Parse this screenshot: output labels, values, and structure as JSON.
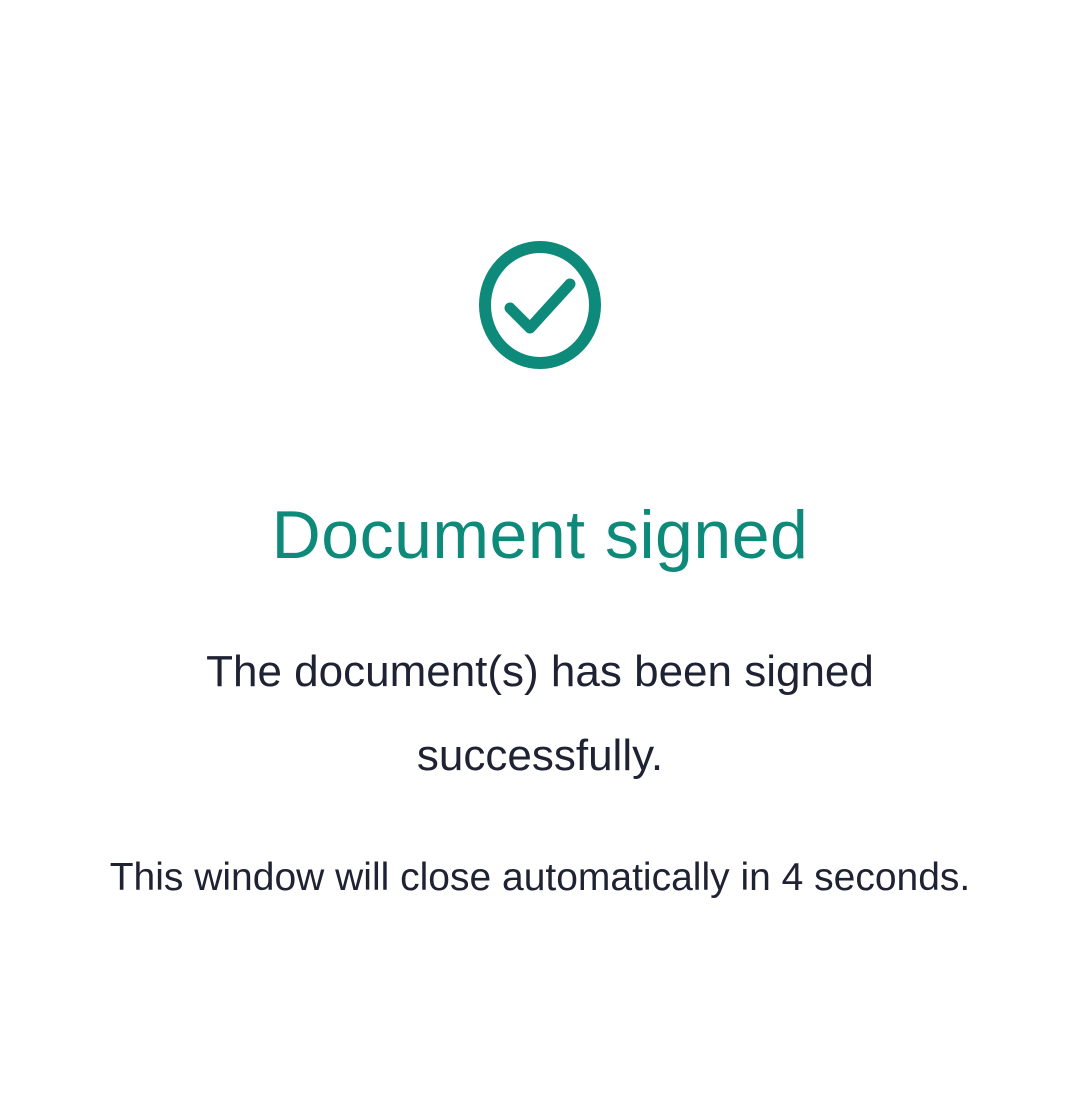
{
  "dialog": {
    "icon": "check-circle-icon",
    "title": "Document signed",
    "message": "The document(s) has been signed successfully.",
    "countdown": "This window will close automatically in 4 seconds."
  },
  "colors": {
    "accent": "#0d8a7a",
    "text": "#1e2233",
    "background": "#ffffff"
  }
}
